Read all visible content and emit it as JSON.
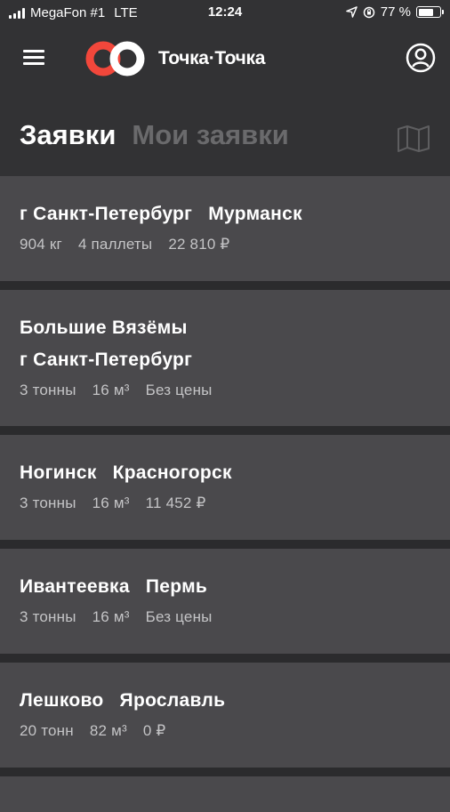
{
  "status_bar": {
    "carrier": "MegaFon #1",
    "network": "LTE",
    "time": "12:24",
    "battery_text": "77 %",
    "battery_level": 0.77
  },
  "header": {
    "logo_text": "Точка·Точка",
    "menu_icon": "hamburger-icon",
    "profile_icon": "user-icon",
    "map_icon": "map-icon"
  },
  "tabs": [
    {
      "label": "Заявки",
      "active": true
    },
    {
      "label": "Мои заявки",
      "active": false
    }
  ],
  "orders": [
    {
      "from": "г Санкт-Петербург",
      "to": "Мурманск",
      "stacked": false,
      "weight": "904 кг",
      "volume": "4 паллеты",
      "price": "22 810 ₽"
    },
    {
      "from": "Большие Вязёмы",
      "to": "г Санкт-Петербург",
      "stacked": true,
      "weight": "3 тонны",
      "volume": "16 м³",
      "price": "Без цены"
    },
    {
      "from": "Ногинск",
      "to": "Красногорск",
      "stacked": false,
      "weight": "3 тонны",
      "volume": "16 м³",
      "price": "11 452 ₽"
    },
    {
      "from": "Ивантеевка",
      "to": "Пермь",
      "stacked": false,
      "weight": "3 тонны",
      "volume": "16 м³",
      "price": "Без цены"
    },
    {
      "from": "Лешково",
      "to": "Ярославль",
      "stacked": false,
      "weight": "20 тонн",
      "volume": "82 м³",
      "price": "0 ₽"
    }
  ],
  "colors": {
    "accent": "#f2473b",
    "background": "#2b2b2d",
    "header": "#323234",
    "card": "#4a494c"
  }
}
